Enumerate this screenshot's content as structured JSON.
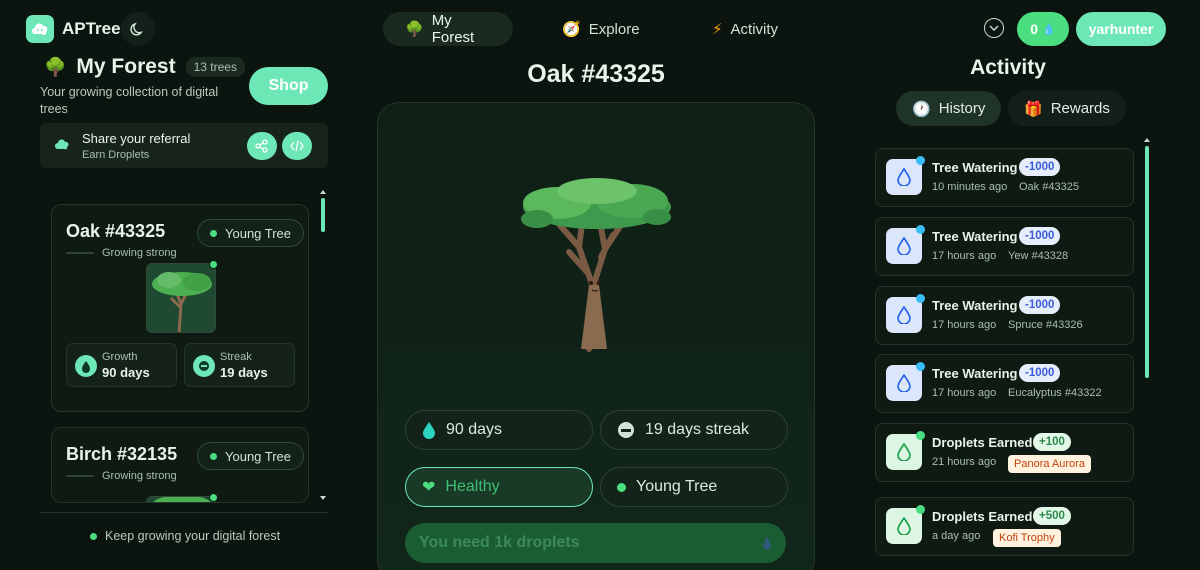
{
  "header": {
    "brand": "APTree",
    "tabs": [
      {
        "label": "My Forest",
        "icon": "tree-icon",
        "active": true
      },
      {
        "label": "Explore",
        "icon": "compass-icon",
        "active": false
      },
      {
        "label": "Activity",
        "icon": "bolt-icon",
        "active": false
      }
    ],
    "droplets": "0",
    "username": "yarhunter"
  },
  "forest": {
    "title": "My Forest",
    "tree_count": "13 trees",
    "subtitle": "Your growing collection of digital trees",
    "shop_label": "Shop",
    "referral_title": "Share your referral",
    "referral_sub": "Earn Droplets",
    "footer": "Keep growing your digital forest",
    "cards": [
      {
        "name": "Oak #43325",
        "status": "Growing strong",
        "stage": "Young Tree",
        "growth_label": "Growth",
        "growth": "90 days",
        "streak_label": "Streak",
        "streak": "19 days"
      },
      {
        "name": "Birch #32135",
        "status": "Growing strong",
        "stage": "Young Tree"
      }
    ]
  },
  "detail": {
    "title": "Oak #43325",
    "growth": "90 days",
    "streak": "19 days streak",
    "health": "Healthy",
    "stage": "Young Tree",
    "cta": "You need 1k droplets"
  },
  "activity": {
    "title": "Activity",
    "tabs": [
      {
        "label": "History",
        "active": true
      },
      {
        "label": "Rewards",
        "active": false
      }
    ],
    "items": [
      {
        "kind": "water",
        "title": "Tree Watering",
        "amount": "-1000",
        "time": "10 minutes ago",
        "ref": "Oak #43325"
      },
      {
        "kind": "water",
        "title": "Tree Watering",
        "amount": "-1000",
        "time": "17 hours ago",
        "ref": "Yew #43328"
      },
      {
        "kind": "water",
        "title": "Tree Watering",
        "amount": "-1000",
        "time": "17 hours ago",
        "ref": "Spruce #43326"
      },
      {
        "kind": "water",
        "title": "Tree Watering",
        "amount": "-1000",
        "time": "17 hours ago",
        "ref": "Eucalyptus #43322"
      },
      {
        "kind": "earn",
        "title": "Droplets Earned",
        "amount": "+100",
        "time": "21 hours ago",
        "ref": "Panora Aurora"
      },
      {
        "kind": "earn",
        "title": "Droplets Earned",
        "amount": "+500",
        "time": "a day ago",
        "ref": "Kofi Trophy"
      }
    ]
  },
  "colors": {
    "accent": "#6ee7b7",
    "accent_strong": "#4ade80",
    "background": "#0b140e"
  }
}
